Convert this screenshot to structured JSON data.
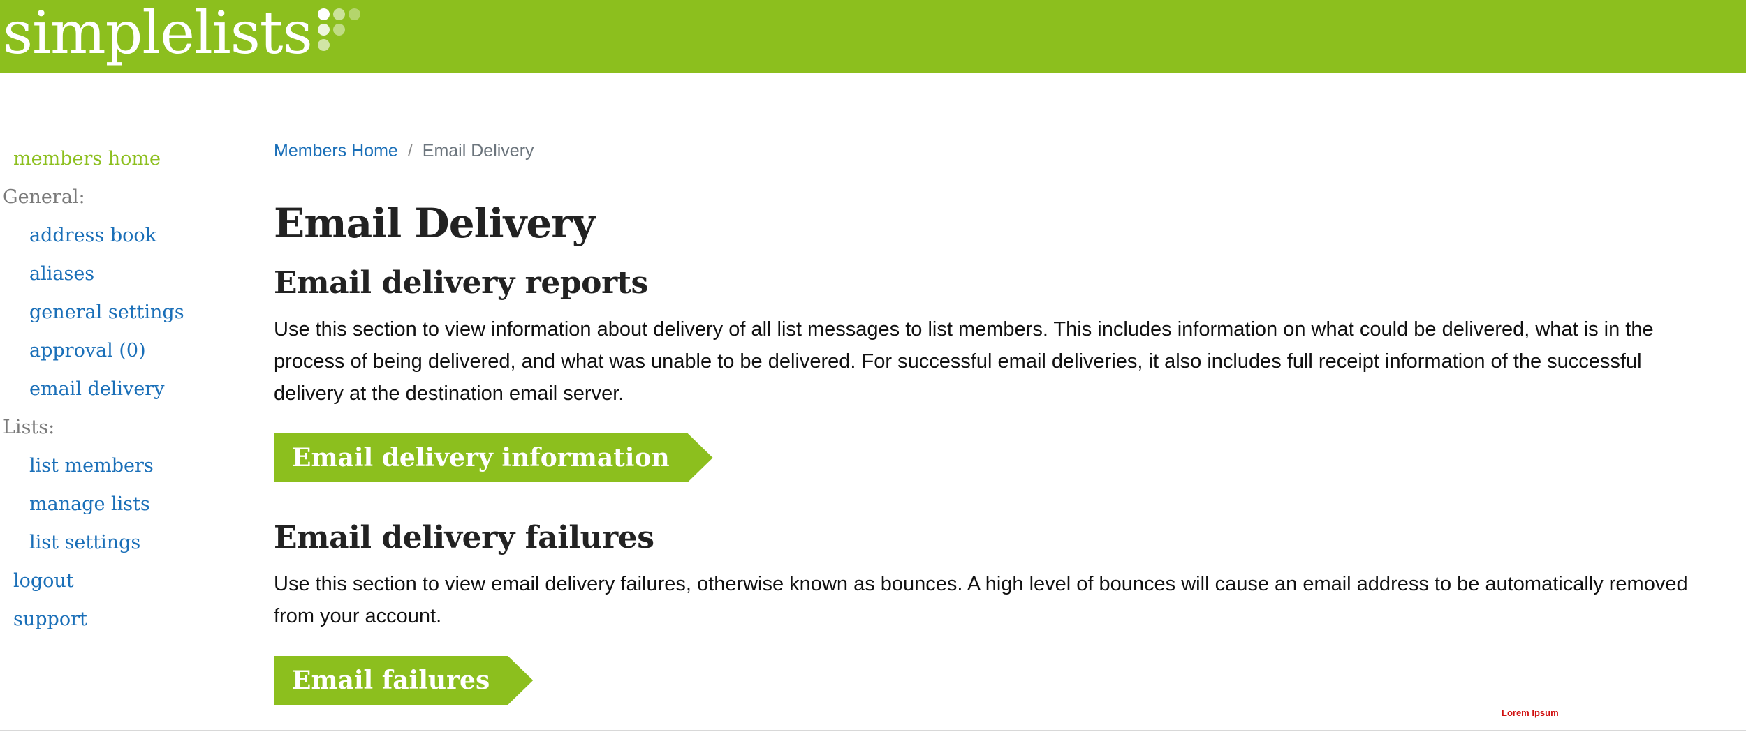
{
  "brand": {
    "name": "simplelists",
    "color": "#8cbf1e"
  },
  "sidebar": {
    "home": "members home",
    "general_heading": "General:",
    "general_items": [
      {
        "label": "address book"
      },
      {
        "label": "aliases"
      },
      {
        "label": "general settings"
      },
      {
        "label": "approval (0)"
      },
      {
        "label": "email delivery"
      }
    ],
    "lists_heading": "Lists:",
    "list_items": [
      {
        "label": "list members"
      },
      {
        "label": "manage lists"
      },
      {
        "label": "list settings"
      }
    ],
    "logout": "logout",
    "support": "support"
  },
  "breadcrumb": {
    "home": "Members Home",
    "separator": "/",
    "current": "Email Delivery"
  },
  "main": {
    "title": "Email Delivery",
    "reports": {
      "heading": "Email delivery reports",
      "body": "Use this section to view information about delivery of all list messages to list members. This includes information on what could be delivered, what is in the process of being delivered, and what was unable to be delivered. For successful email deliveries, it also includes full receipt information of the successful delivery at the destination email server.",
      "button": "Email delivery information"
    },
    "failures": {
      "heading": "Email delivery failures",
      "body": "Use this section to view email delivery failures, otherwise known as bounces. A high level of bounces will cause an email address to be automatically removed from your account.",
      "button": "Email failures"
    }
  },
  "footer": {
    "note": "Lorem Ipsum"
  },
  "colors": {
    "accent": "#8cbf1e",
    "link": "#1a6fb8",
    "heading": "#222222",
    "muted": "#7a7a7a",
    "footer_note": "#d01010"
  }
}
